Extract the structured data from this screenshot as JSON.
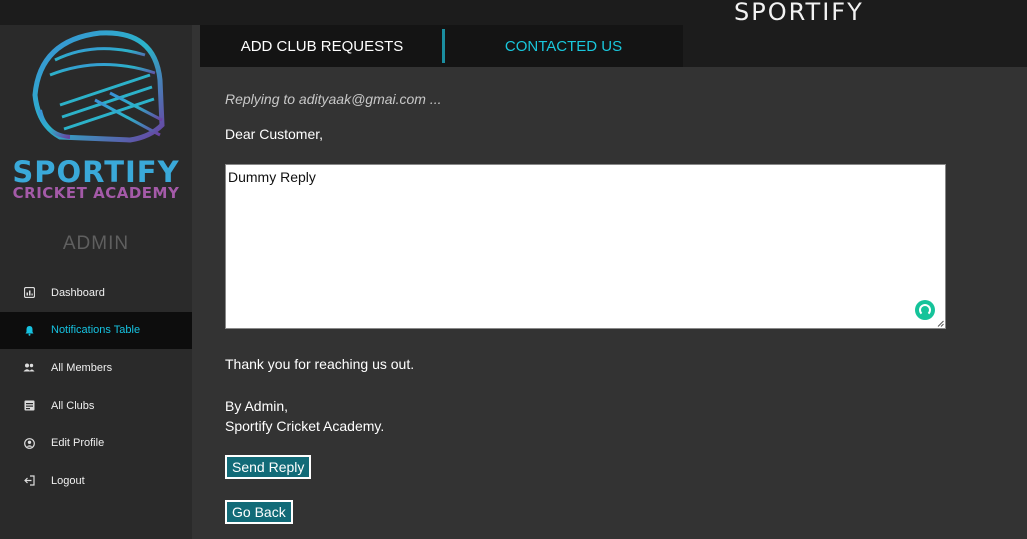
{
  "header": {
    "brand": "SPORTIFY"
  },
  "sidebar": {
    "logo_line1": "SPORTIFY",
    "logo_line2": "CRICKET ACADEMY",
    "role": "ADMIN",
    "items": [
      {
        "label": "Dashboard",
        "icon": "chart-icon",
        "active": false
      },
      {
        "label": "Notifications Table",
        "icon": "bell-icon",
        "active": true
      },
      {
        "label": "All Members",
        "icon": "users-icon",
        "active": false
      },
      {
        "label": "All Clubs",
        "icon": "list-icon",
        "active": false
      },
      {
        "label": "Edit Profile",
        "icon": "user-circle-icon",
        "active": false
      },
      {
        "label": "Logout",
        "icon": "logout-icon",
        "active": false
      }
    ]
  },
  "tabs": [
    {
      "label": "ADD CLUB REQUESTS"
    },
    {
      "label": "CONTACTED US"
    }
  ],
  "reply": {
    "replying_to": "Replying to adityaak@gmai.com ...",
    "greeting": "Dear Customer,",
    "message": "Dummy Reply",
    "thanks": "Thank you for reaching us out.",
    "signoff_line1": "By Admin,",
    "signoff_line2": "Sportify Cricket Academy.",
    "send_label": "Send Reply",
    "back_label": "Go Back"
  },
  "colors": {
    "accent": "#16c2e0",
    "button": "#126b78",
    "grammar": "#15c39a",
    "logo_blue": "#3aa9d9",
    "logo_purple": "#a45aa8"
  }
}
